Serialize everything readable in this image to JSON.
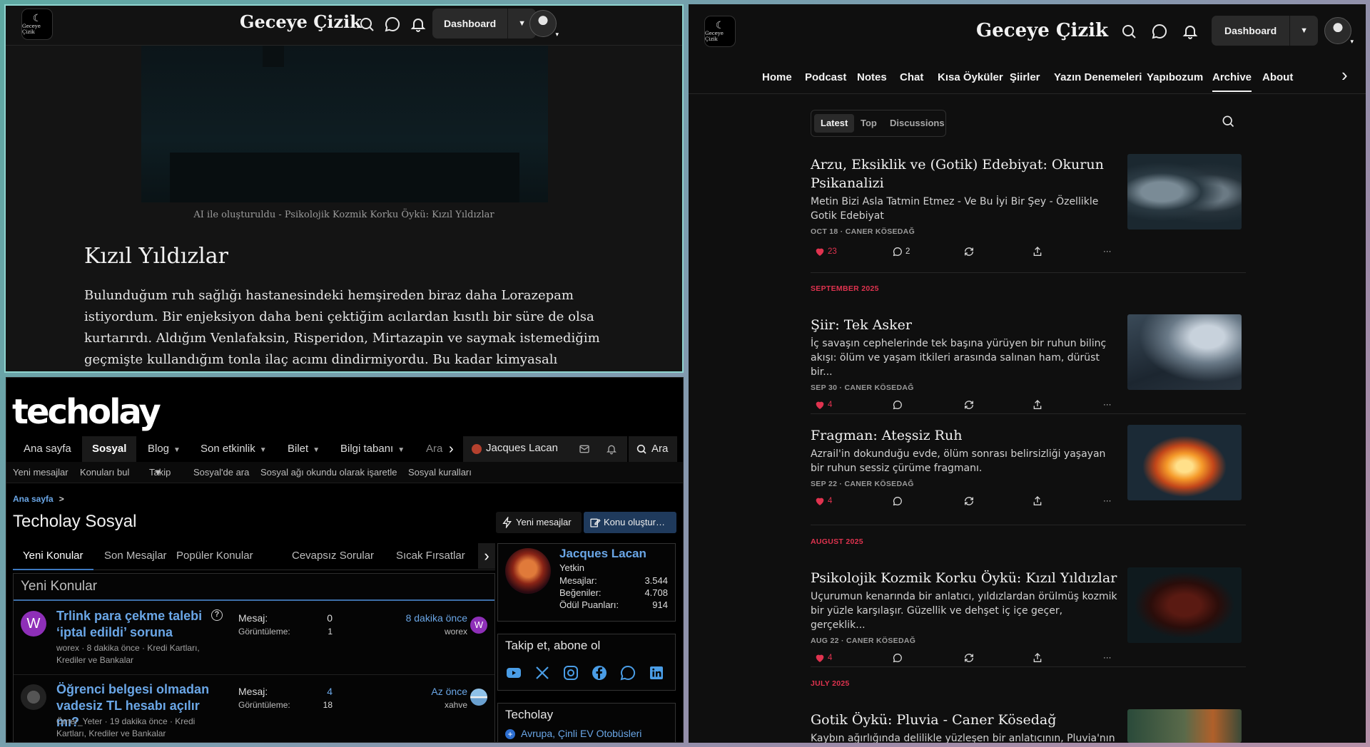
{
  "colors": {
    "accent_red": "#e0334f",
    "link_blue": "#6aa6e6",
    "forum_active_tab": "#3d79bf",
    "heart": "#e0334f"
  },
  "left_top": {
    "logo_text": "Geceye Çizik",
    "site_title": "Geceye Çizik",
    "dashboard_label": "Dashboard",
    "icons": [
      "search-icon",
      "chat-icon",
      "bell-icon",
      "chevron-down-icon"
    ],
    "image_caption": "AI ile oluşturuldu - Psikolojik Kozmik Korku Öykü: Kızıl Yıldızlar",
    "heading": "Kızıl Yıldızlar",
    "paragraph": "Bulunduğum ruh sağlığı hastanesindeki hemşireden biraz daha Lorazepam istiyordum. Bir enjeksiyon daha beni çektiğim acılardan kısıtlı bir süre de olsa kurtarırdı. Aldığım Venlafaksin, Risperidon, Mirtazapin ve saymak istemediğim geçmişte kullandığım tonla ilaç acımı dindirmiyordu. Bu kadar kimyasalı"
  },
  "forum": {
    "logo": "techolay",
    "nav": {
      "home": "Ana sayfa",
      "social": "Sosyal",
      "blog": "Blog",
      "recent": "Son etkinlik",
      "ticket": "Bilet",
      "kb": "Bilgi tabanı",
      "more": "Ara"
    },
    "user_name": "Jacques Lacan",
    "search_label": "Ara",
    "subnav": [
      "Yeni mesajlar",
      "Konuları bul",
      "Takip",
      "Sosyal'de ara",
      "Sosyal ağı okundu olarak işaretle",
      "Sosyal kuralları"
    ],
    "breadcrumb": "Ana sayfa",
    "breadcrumb_sep": ">",
    "title": "Techolay Sosyal",
    "btn_new_messages": "Yeni mesajlar",
    "btn_create_thread": "Konu oluştur…",
    "tabs": [
      "Yeni Konular",
      "Son Mesajlar",
      "Popüler Konular",
      "Cevapsız Sorular",
      "Sıcak Fırsatlar"
    ],
    "panel_title": "Yeni Konular",
    "threads": [
      {
        "title": "Trlink para çekme talebi ‘iptal edildi’ soruna",
        "meta": "worex · 8 dakika önce · Kredi Kartları, Krediler ve Bankalar",
        "avatar_letter": "W",
        "help_icon": "?",
        "label_msgs": "Mesaj:",
        "msgs": "0",
        "label_views": "Görüntüleme:",
        "views": "1",
        "last_time": "8 dakika önce",
        "last_user": "worex",
        "last_avatar_letter": "W"
      },
      {
        "title": "Öğrenci belgesi olmadan vadesiz TL hesabı açılır mı?",
        "meta": "Ömer_Yeter · 19 dakika önce · Kredi Kartları, Krediler ve Bankalar",
        "avatar_letter": "",
        "label_msgs": "Mesaj:",
        "msgs": "4",
        "label_views": "Görüntüleme:",
        "views": "18",
        "last_time": "Az önce",
        "last_user": "xahve",
        "last_avatar_letter": ""
      }
    ],
    "profile": {
      "name": "Jacques Lacan",
      "rank": "Yetkin",
      "stats": [
        {
          "label": "Mesajlar:",
          "value": "3.544"
        },
        {
          "label": "Beğeniler:",
          "value": "4.708"
        },
        {
          "label": "Ödül Puanları:",
          "value": "914"
        }
      ]
    },
    "follow_title": "Takip et, abone ol",
    "social_icons": [
      "youtube-icon",
      "x-icon",
      "instagram-icon",
      "facebook-icon",
      "whatsapp-icon",
      "linkedin-icon"
    ],
    "techolay_box_title": "Techolay",
    "techolay_box_item": "Avrupa, Çinli EV Otobüsleri"
  },
  "right": {
    "logo_text": "Geceye Çizik",
    "site_title": "Geceye Çizik",
    "dashboard_label": "Dashboard",
    "nav": [
      "Home",
      "Podcast",
      "Notes",
      "Chat",
      "Kısa Öyküler",
      "Şiirler",
      "Yazın Denemeleri",
      "Yapıbozum",
      "Archive",
      "About"
    ],
    "active_nav": "Archive",
    "segments": [
      "Latest",
      "Top",
      "Discussions"
    ],
    "months": [
      "SEPTEMBER 2025",
      "AUGUST 2025",
      "JULY 2025"
    ],
    "posts": [
      {
        "title": "Arzu, Eksiklik ve (Gotik) Edebiyat: Okurun Psikanalizi",
        "subtitle": "Metin Bizi Asla Tatmin Etmez - Ve Bu İyi Bir Şey - Özellikle Gotik Edebiyat",
        "meta": "OCT 18 · CANER KÖSEDAĞ",
        "likes": "23",
        "comments": "2",
        "more": "···"
      },
      {
        "title": "Şiir: Tek Asker",
        "subtitle": "İç savaşın cephelerinde tek başına yürüyen bir ruhun bilinç akışı: ölüm ve yaşam itkileri arasında salınan ham, dürüst bir...",
        "meta": "SEP 30 · CANER KÖSEDAĞ",
        "likes": "4",
        "comments": "",
        "more": "···"
      },
      {
        "title": "Fragman: Ateşsiz Ruh",
        "subtitle": "Azrail'in dokunduğu evde, ölüm sonrası belirsizliği yaşayan bir ruhun sessiz çürüme fragmanı.",
        "meta": "SEP 22 · CANER KÖSEDAĞ",
        "likes": "4",
        "comments": "",
        "more": "···"
      },
      {
        "title": "Psikolojik Kozmik Korku Öykü: Kızıl Yıldızlar",
        "subtitle": "Uçurumun kenarında bir anlatıcı, yıldızlardan örülmüş kozmik bir yüzle karşılaşır. Güzellik ve dehşet iç içe geçer, gerçeklik...",
        "meta": "AUG 22 · CANER KÖSEDAĞ",
        "likes": "4",
        "comments": "",
        "more": "···"
      },
      {
        "title": "Gotik Öykü: Pluvia - Caner Kösedağ",
        "subtitle": "Kaybın ağırlığında delilikle yüzleşen bir anlatıcının, Pluvia'nın",
        "meta": "",
        "likes": "",
        "comments": "",
        "more": ""
      }
    ]
  }
}
